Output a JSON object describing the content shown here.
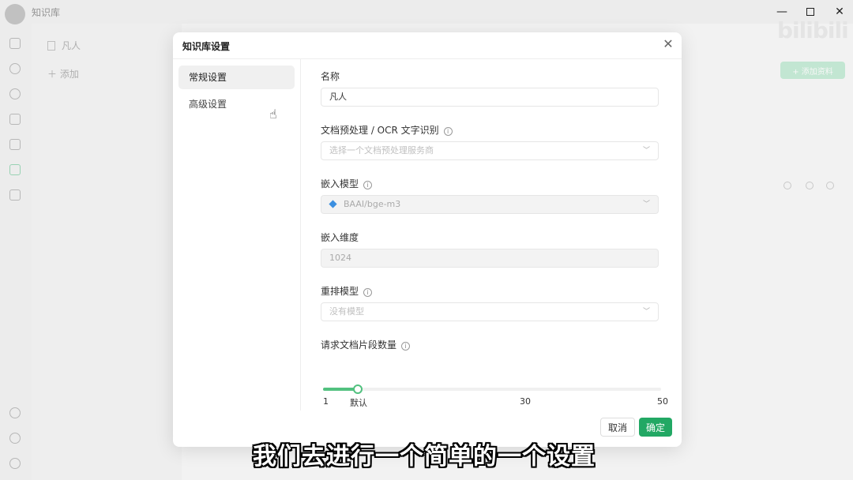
{
  "app": {
    "title": "知识库",
    "bg_list_items": [
      "凡人",
      "添加"
    ],
    "bg_add_button": "+ 添加资料"
  },
  "dialog": {
    "title": "知识库设置",
    "sidebar": [
      {
        "label": "常规设置",
        "active": true
      },
      {
        "label": "高级设置",
        "active": false
      }
    ],
    "fields": {
      "name": {
        "label": "名称",
        "value": "凡人"
      },
      "preprocess": {
        "label": "文档预处理 / OCR 文字识别",
        "placeholder": "选择一个文档预处理服务商"
      },
      "embed_model": {
        "label": "嵌入模型",
        "value": "BAAI/bge-m3"
      },
      "embed_dim": {
        "label": "嵌入维度",
        "value": "1024"
      },
      "rerank_model": {
        "label": "重排模型",
        "placeholder": "没有模型"
      },
      "chunk_count": {
        "label": "请求文档片段数量",
        "min_label": "1",
        "default_label": "默认",
        "mid_label": "30",
        "max_label": "50",
        "value": 6,
        "min": 1,
        "max": 50
      }
    },
    "buttons": {
      "cancel": "取消",
      "ok": "确定"
    }
  },
  "subtitle": "我们去进行一个简单的一个设置",
  "colors": {
    "accent": "#22a864",
    "slider": "#52c17f"
  }
}
